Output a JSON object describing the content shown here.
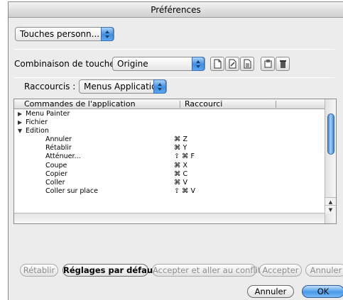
{
  "window": {
    "title": "Préférences"
  },
  "top_popup": {
    "value": "Touches personn..."
  },
  "shortcut_set": {
    "label": "Combinaison de touches",
    "value": "Origine"
  },
  "shortcuts_popup": {
    "label": "Raccourcis :",
    "value": "Menus Applicatio..."
  },
  "toolbar_icons": [
    "new-set-icon",
    "save-set-icon",
    "save-as-icon",
    "export-icon",
    "delete-icon"
  ],
  "table": {
    "headers": {
      "command": "Commandes de l'application",
      "shortcut": "Raccourci"
    },
    "rows": [
      {
        "kind": "group",
        "tri": "▶",
        "name": "Menu Painter",
        "shortcut": ""
      },
      {
        "kind": "group",
        "tri": "▶",
        "name": "Fichier",
        "shortcut": ""
      },
      {
        "kind": "group",
        "tri": "▼",
        "name": "Edition",
        "shortcut": ""
      },
      {
        "kind": "child",
        "tri": "",
        "name": "Annuler",
        "shortcut": "⌘ Z"
      },
      {
        "kind": "child",
        "tri": "",
        "name": "Rétablir",
        "shortcut": "⌘ Y"
      },
      {
        "kind": "child",
        "tri": "",
        "name": "Atténuer...",
        "shortcut": "⇧ ⌘ F"
      },
      {
        "kind": "child",
        "tri": "",
        "name": "Coupe",
        "shortcut": "⌘ X"
      },
      {
        "kind": "child",
        "tri": "",
        "name": "Copier",
        "shortcut": "⌘ C"
      },
      {
        "kind": "child",
        "tri": "",
        "name": "Coller",
        "shortcut": "⌘ V"
      },
      {
        "kind": "child",
        "tri": "",
        "name": "Coller sur place",
        "shortcut": "⇧ ⌘ V"
      }
    ]
  },
  "buttons": {
    "retablir": "Rétablir",
    "reglages": "Réglages par défaut",
    "accepter_conflit": "Accepter et aller au conflit",
    "accepter": "Accepter",
    "annuler_row": "Annuler",
    "annuler": "Annuler",
    "ok": "OK"
  }
}
